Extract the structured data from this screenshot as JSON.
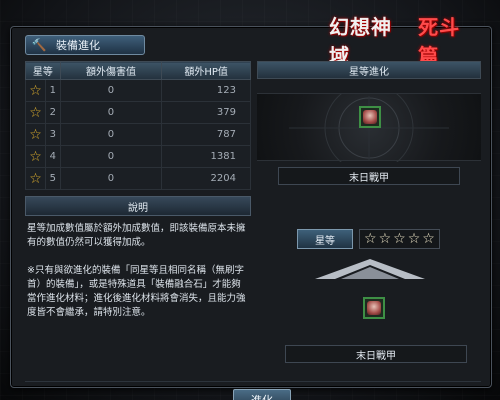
{
  "window": {
    "title": "裝備進化",
    "logo_part1": "幻想神域",
    "logo_part2": "死斗篇"
  },
  "table": {
    "headers": [
      "星等",
      "額外傷害值",
      "額外HP值"
    ],
    "rows": [
      {
        "grade": "1",
        "dmg": "0",
        "hp": "123"
      },
      {
        "grade": "2",
        "dmg": "0",
        "hp": "379"
      },
      {
        "grade": "3",
        "dmg": "0",
        "hp": "787"
      },
      {
        "grade": "4",
        "dmg": "0",
        "hp": "1381"
      },
      {
        "grade": "5",
        "dmg": "0",
        "hp": "2204"
      }
    ]
  },
  "desc": {
    "header": "說明",
    "text1": "星等加成數值屬於額外加成數值，即該裝備原本未擁有的數值仍然可以獲得加成。",
    "text2": "※只有與欲進化的裝備「同星等且相同名稱（無刷字首）的裝備」，或是特殊道具「裝備融合石」才能夠當作進化材料；進化後進化材料將會消失，且能力強度皆不會繼承，請特別注意。"
  },
  "right": {
    "header": "星等進化",
    "item_name": "末日戰甲",
    "grade_label": "星等",
    "grade_stars": 5,
    "result_item_name": "末日戰甲"
  },
  "footer": {
    "action_label": "進化"
  },
  "colors": {
    "accent_blue": "#3e6079",
    "slot_green": "#3e8f45",
    "star_gold": "#e2b12d"
  },
  "icons": {
    "title_icon": "hammer-icon",
    "star_icon": "star-icon",
    "armor_icon": "armor-icon",
    "arrow_icon": "up-arrow-icon"
  }
}
